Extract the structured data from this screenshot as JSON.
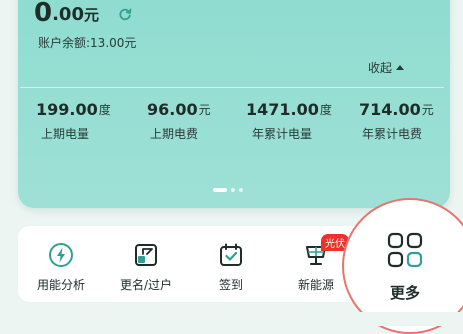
{
  "account": {
    "amount_integer": "0",
    "amount_decimal": ".00",
    "amount_unit": "元",
    "balance_text": "账户余额:13.00元",
    "collapse_label": "收起"
  },
  "stats": [
    {
      "value": "199.00",
      "unit": "度",
      "label": "上期电量"
    },
    {
      "value": "96.00",
      "unit": "元",
      "label": "上期电费"
    },
    {
      "value": "1471.00",
      "unit": "度",
      "label": "年累计电量"
    },
    {
      "value": "714.00",
      "unit": "元",
      "label": "年累计电费"
    }
  ],
  "carousel": {
    "pages": 3,
    "active": 1
  },
  "menu": [
    {
      "label": "用能分析",
      "icon": "lightning-icon"
    },
    {
      "label": "更名/过户",
      "icon": "transfer-icon"
    },
    {
      "label": "签到",
      "icon": "calendar-check-icon"
    },
    {
      "label": "新能源",
      "icon": "solar-panel-icon",
      "badge": "光伏"
    },
    {
      "label": "更多",
      "icon": "grid-icon"
    }
  ],
  "colors": {
    "accent": "#2fa193",
    "card": "#94ddd3",
    "highlight_ring": "#e3776f",
    "badge": "#e9322a"
  }
}
